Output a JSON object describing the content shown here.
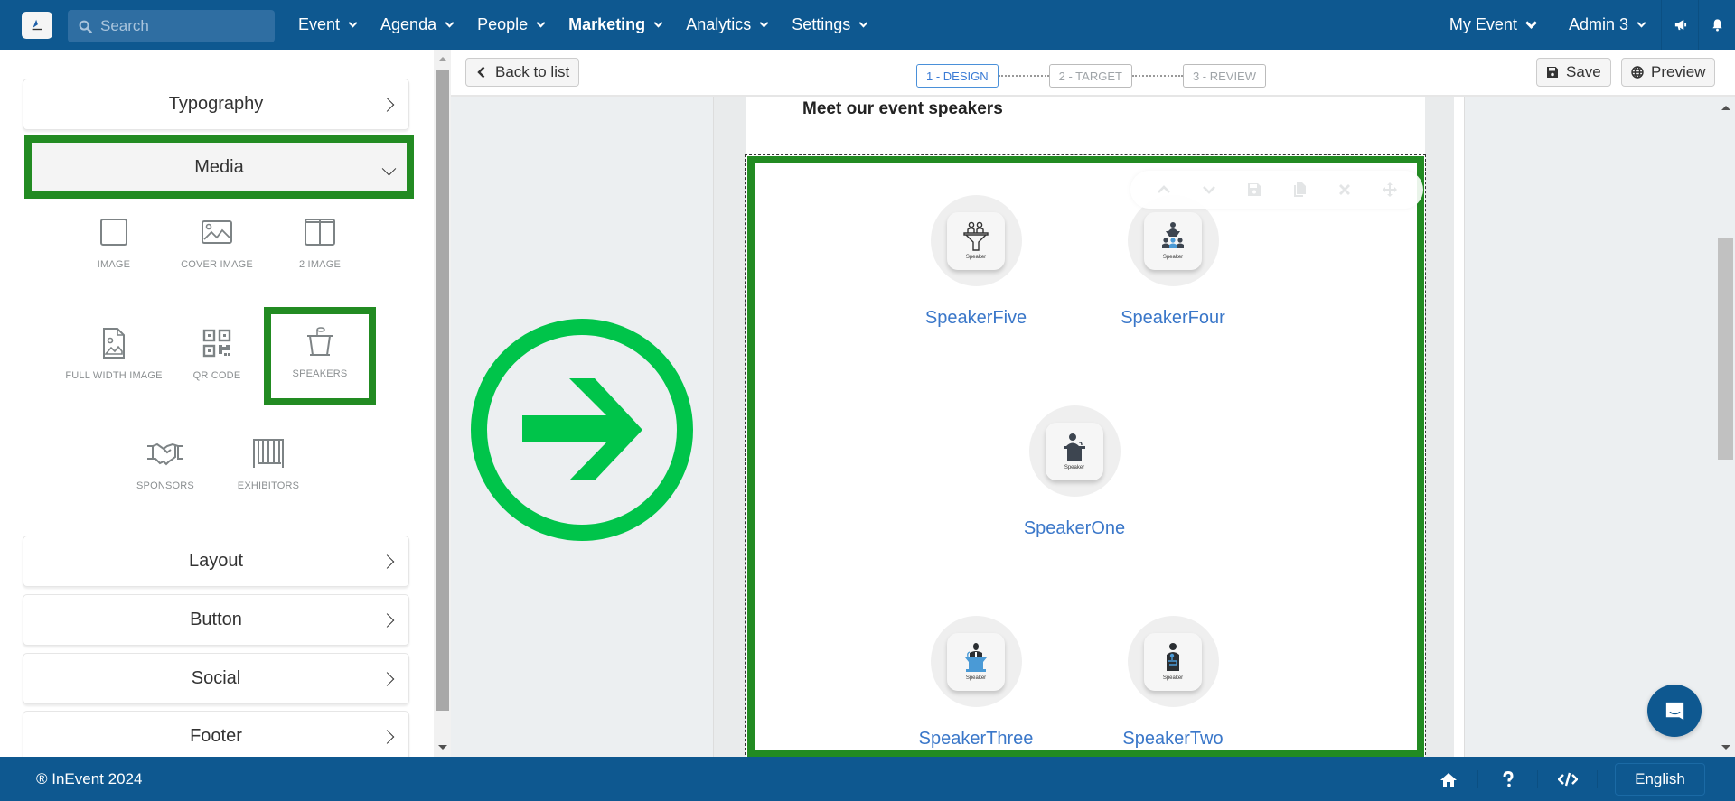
{
  "topbar": {
    "search_placeholder": "Search",
    "nav": [
      {
        "label": "Event",
        "active": false
      },
      {
        "label": "Agenda",
        "active": false
      },
      {
        "label": "People",
        "active": false
      },
      {
        "label": "Marketing",
        "active": true
      },
      {
        "label": "Analytics",
        "active": false
      },
      {
        "label": "Settings",
        "active": false
      }
    ],
    "event_selector": "My Event",
    "user_menu": "Admin 3",
    "icons": [
      "megaphone-icon",
      "bell-icon"
    ]
  },
  "sidebar": {
    "sections_top": [
      {
        "label": "Typography",
        "state": "collapsed"
      },
      {
        "label": "Media",
        "state": "expanded",
        "highlighted": true
      }
    ],
    "media_tiles": [
      {
        "label": "IMAGE",
        "icon": "image-icon"
      },
      {
        "label": "COVER IMAGE",
        "icon": "cover-image-icon"
      },
      {
        "label": "2 IMAGE",
        "icon": "two-image-icon"
      },
      {
        "label": "FULL WIDTH IMAGE",
        "icon": "full-width-image-icon"
      },
      {
        "label": "QR CODE",
        "icon": "qr-code-icon"
      },
      {
        "label": "SPEAKERS",
        "icon": "podium-icon",
        "highlighted": true
      },
      {
        "label": "SPONSORS",
        "icon": "handshake-icon"
      },
      {
        "label": "EXHIBITORS",
        "icon": "exhibitors-icon"
      }
    ],
    "sections_bottom": [
      {
        "label": "Layout"
      },
      {
        "label": "Button"
      },
      {
        "label": "Social"
      },
      {
        "label": "Footer"
      }
    ]
  },
  "editor": {
    "back_label": "Back to list",
    "steps": [
      {
        "label": "1 - DESIGN",
        "active": true
      },
      {
        "label": "2 - TARGET",
        "active": false
      },
      {
        "label": "3 - REVIEW",
        "active": false
      }
    ],
    "save_label": "Save",
    "preview_label": "Preview"
  },
  "email": {
    "title": "Meet our event speakers",
    "block_tools": [
      "move-up-icon",
      "move-down-icon",
      "save-icon",
      "copy-icon",
      "delete-icon",
      "drag-icon"
    ],
    "speakers": [
      {
        "name": "SpeakerFive",
        "caption": "Speaker"
      },
      {
        "name": "SpeakerFour",
        "caption": "Speaker"
      },
      {
        "name": "SpeakerOne",
        "caption": "Speaker"
      },
      {
        "name": "SpeakerThree",
        "caption": "Speaker"
      },
      {
        "name": "SpeakerTwo",
        "caption": "Speaker"
      }
    ]
  },
  "annotation": {
    "icon": "arrow-right-circle-icon",
    "color": "#00c44a"
  },
  "footer": {
    "copyright": "® InEvent 2024",
    "language": "English"
  },
  "colors": {
    "brand": "#0e5890",
    "highlight": "#228b22",
    "link": "#3a77c9"
  }
}
